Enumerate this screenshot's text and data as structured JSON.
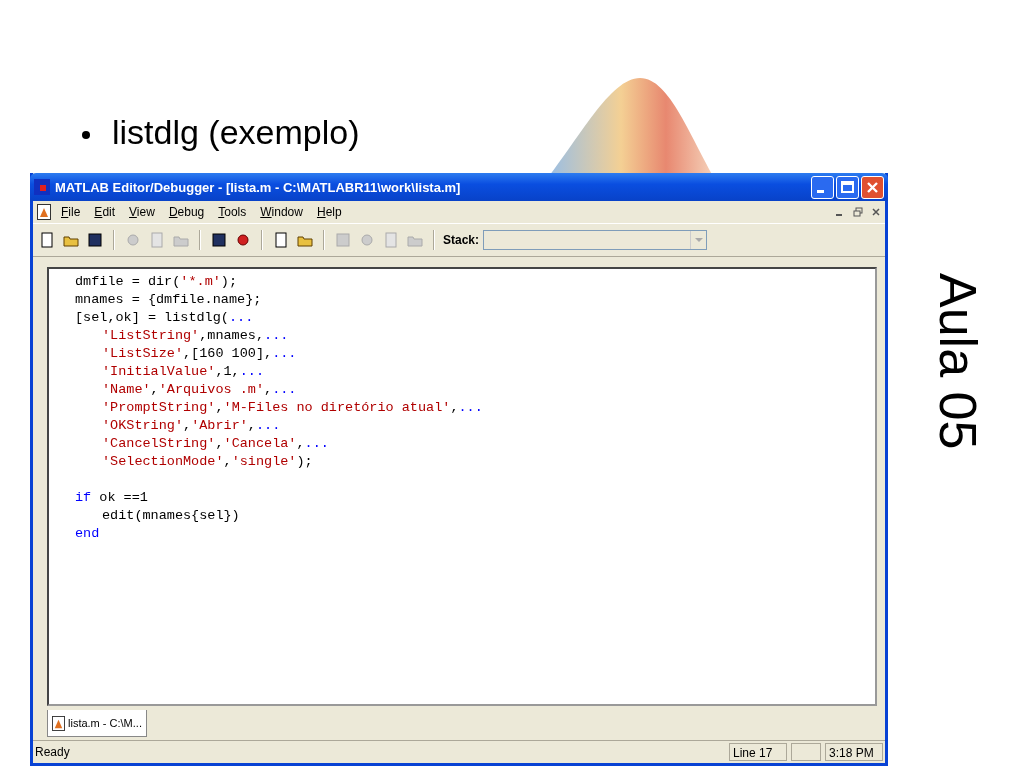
{
  "slide": {
    "bullet": "listdlg (exemplo)",
    "side_title": "Aula 05"
  },
  "window": {
    "title": "MATLAB Editor/Debugger - [lista.m - C:\\MATLABR11\\work\\lista.m]"
  },
  "menu": [
    "File",
    "Edit",
    "View",
    "Debug",
    "Tools",
    "Window",
    "Help"
  ],
  "toolbar": {
    "groups": [
      [
        {
          "disabled": false
        },
        {
          "disabled": false
        },
        {
          "disabled": false
        }
      ],
      [
        {
          "disabled": true
        },
        {
          "disabled": true
        },
        {
          "disabled": true
        }
      ],
      [
        {
          "disabled": false
        },
        {
          "disabled": false
        }
      ],
      [
        {
          "disabled": false
        },
        {
          "disabled": false
        }
      ],
      [
        {
          "disabled": true
        },
        {
          "disabled": true
        },
        {
          "disabled": true
        },
        {
          "disabled": true
        }
      ]
    ],
    "stack_label": "Stack:"
  },
  "editor": {
    "lines": [
      {
        "indented": false,
        "segments": [
          {
            "kind": "code",
            "text": "dmfile = dir("
          },
          {
            "kind": "string",
            "text": "'*.m'"
          },
          {
            "kind": "code",
            "text": ");"
          }
        ]
      },
      {
        "indented": false,
        "segments": [
          {
            "kind": "code",
            "text": "mnames = {dmfile.name};"
          }
        ]
      },
      {
        "indented": false,
        "segments": [
          {
            "kind": "code",
            "text": "[sel,ok] = listdlg("
          },
          {
            "kind": "continuation",
            "text": "..."
          }
        ]
      },
      {
        "indented": true,
        "segments": [
          {
            "kind": "string",
            "text": "'ListString'"
          },
          {
            "kind": "code",
            "text": ",mnames,"
          },
          {
            "kind": "continuation",
            "text": "..."
          }
        ]
      },
      {
        "indented": true,
        "segments": [
          {
            "kind": "string",
            "text": "'ListSize'"
          },
          {
            "kind": "code",
            "text": ",[160 100],"
          },
          {
            "kind": "continuation",
            "text": "..."
          }
        ]
      },
      {
        "indented": true,
        "segments": [
          {
            "kind": "string",
            "text": "'InitialValue'"
          },
          {
            "kind": "code",
            "text": ",1,"
          },
          {
            "kind": "continuation",
            "text": "..."
          }
        ]
      },
      {
        "indented": true,
        "segments": [
          {
            "kind": "string",
            "text": "'Name'"
          },
          {
            "kind": "code",
            "text": ","
          },
          {
            "kind": "string",
            "text": "'Arquivos .m'"
          },
          {
            "kind": "code",
            "text": ","
          },
          {
            "kind": "continuation",
            "text": "..."
          }
        ]
      },
      {
        "indented": true,
        "segments": [
          {
            "kind": "string",
            "text": "'PromptString'"
          },
          {
            "kind": "code",
            "text": ","
          },
          {
            "kind": "string",
            "text": "'M-Files no diretório atual'"
          },
          {
            "kind": "code",
            "text": ","
          },
          {
            "kind": "continuation",
            "text": "..."
          }
        ]
      },
      {
        "indented": true,
        "segments": [
          {
            "kind": "string",
            "text": "'OKString'"
          },
          {
            "kind": "code",
            "text": ","
          },
          {
            "kind": "string",
            "text": "'Abrir'"
          },
          {
            "kind": "code",
            "text": ","
          },
          {
            "kind": "continuation",
            "text": "..."
          }
        ]
      },
      {
        "indented": true,
        "segments": [
          {
            "kind": "string",
            "text": "'CancelString'"
          },
          {
            "kind": "code",
            "text": ","
          },
          {
            "kind": "string",
            "text": "'Cancela'"
          },
          {
            "kind": "code",
            "text": ","
          },
          {
            "kind": "continuation",
            "text": "..."
          }
        ]
      },
      {
        "indented": true,
        "segments": [
          {
            "kind": "string",
            "text": "'SelectionMode'"
          },
          {
            "kind": "code",
            "text": ","
          },
          {
            "kind": "string",
            "text": "'single'"
          },
          {
            "kind": "code",
            "text": ");"
          }
        ]
      },
      {
        "kind": "blank"
      },
      {
        "indented": false,
        "segments": [
          {
            "kind": "keyword",
            "text": "if"
          },
          {
            "kind": "code",
            "text": " ok ==1"
          }
        ]
      },
      {
        "indented": true,
        "segments": [
          {
            "kind": "code",
            "text": "edit(mnames{sel})"
          }
        ]
      },
      {
        "indented": false,
        "segments": [
          {
            "kind": "keyword",
            "text": "end"
          }
        ]
      }
    ]
  },
  "tabs": [
    {
      "label": "lista.m - C:\\M...",
      "selected": true
    }
  ],
  "status_bar": {
    "message": "Ready",
    "line": "Line 17",
    "time": "3:18 PM"
  }
}
